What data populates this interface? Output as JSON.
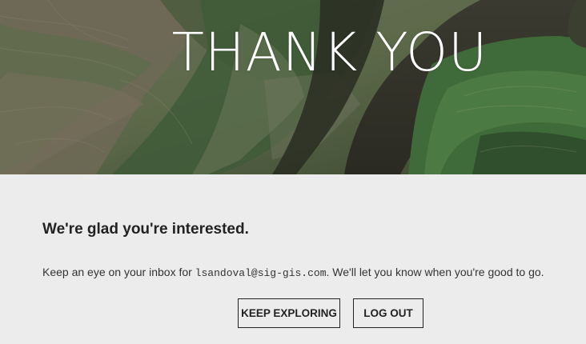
{
  "hero": {
    "title": "THANK YOU",
    "background": "satellite-imagery"
  },
  "content": {
    "heading": "We're glad you're interested.",
    "message_prefix": "Keep an eye on your inbox for ",
    "email": "lsandoval@sig-gis.com",
    "message_suffix": ". We'll let you know when you're good to go."
  },
  "actions": {
    "keep_exploring_label": "KEEP EXPLORING",
    "log_out_label": "LOG OUT"
  },
  "colors": {
    "page_background": "#ececec",
    "text": "#222222",
    "button_border": "#222222",
    "hero_title": "#ffffff"
  }
}
